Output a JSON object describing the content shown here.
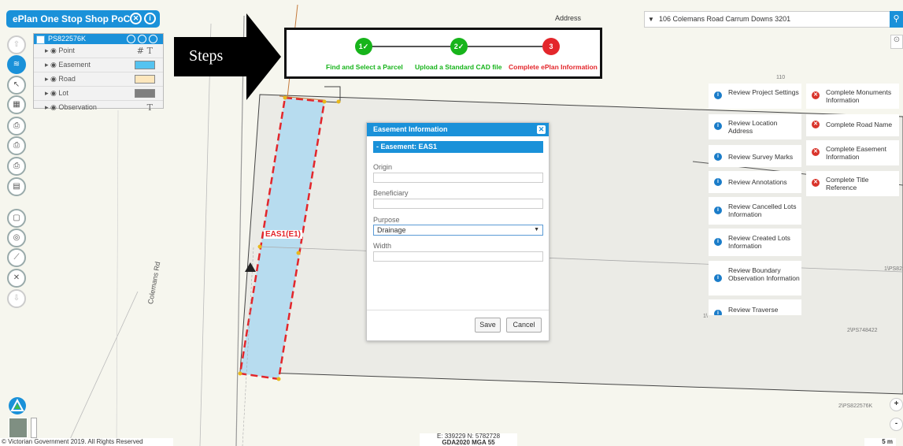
{
  "app": {
    "title": "ePlan One Stop Shop PoC",
    "title_icons": [
      "close-circle-icon",
      "info-icon"
    ]
  },
  "layers": {
    "plan_id": "PS822576K",
    "items": [
      {
        "label": "Point",
        "swatch": null
      },
      {
        "label": "Easement",
        "swatch": "#55c3f0"
      },
      {
        "label": "Road",
        "swatch": "#fde7bd"
      },
      {
        "label": "Lot",
        "swatch": "#7f7f7f"
      },
      {
        "label": "Observation",
        "swatch": null
      }
    ],
    "tools": [
      "hash-icon",
      "text-icon"
    ]
  },
  "toolbar": [
    "upload-icon",
    "layers-icon",
    "pointer-icon",
    "map-icon",
    "print-icon",
    "print-icon",
    "print-icon",
    "document-icon",
    "form-icon",
    "target-icon",
    "measure-icon",
    "delete-icon",
    "download-icon"
  ],
  "annotation": {
    "label": "Steps"
  },
  "stepper": {
    "steps": [
      {
        "label": "Find and Select a Parcel",
        "badge": "1✓",
        "status": "done",
        "color": "#17b41b"
      },
      {
        "label": "Upload a Standard CAD file",
        "badge": "2✓",
        "status": "done",
        "color": "#17b41b"
      },
      {
        "label": "Complete ePlan Information",
        "badge": "3",
        "status": "current",
        "color": "#e3262b"
      }
    ]
  },
  "address": {
    "label": "Address",
    "value": "106 Colemans Road Carrum Downs 3201"
  },
  "dialog": {
    "title": "Easement Information",
    "section": "- Easement: EAS1",
    "fields": [
      {
        "label": "Origin",
        "value": ""
      },
      {
        "label": "Beneficiary",
        "value": ""
      },
      {
        "label": "Purpose",
        "value": "Drainage"
      },
      {
        "label": "Width",
        "value": ""
      }
    ],
    "save": "Save",
    "cancel": "Cancel"
  },
  "tasks_review": [
    "Review Project Settings",
    "Review Location Address",
    "Review Survey Marks",
    "Review Annotations",
    "Review Cancelled Lots Information",
    "Review Created Lots Information",
    "Review Boundary Observation Information",
    "Review Traverse"
  ],
  "tasks_complete": [
    "Complete Monuments Information",
    "Complete Road Name",
    "Complete Easement Information",
    "Complete Title Reference"
  ],
  "map_labels": {
    "easement": "EAS1(E1)",
    "road": "Colemans Rd",
    "lot_top": "110",
    "lot_a": "2\\PS748422",
    "lot_b": "2\\PS822576K",
    "lot_c": "1\\PS82",
    "lot_d": "1\\"
  },
  "footer": {
    "coords": "E: 339229   N: 5782728",
    "datum": "GDA2020 MGA 55",
    "copyright": "© Victorian Government 2019. All Rights Reserved",
    "scale": "5 m",
    "zoom_in": "+",
    "zoom_out": "-"
  },
  "colors": {
    "accent": "#1a91d9",
    "done": "#17b41b",
    "error": "#e3262b",
    "easement_fill": "#b7dcef",
    "easement_border": "#e3262b"
  }
}
